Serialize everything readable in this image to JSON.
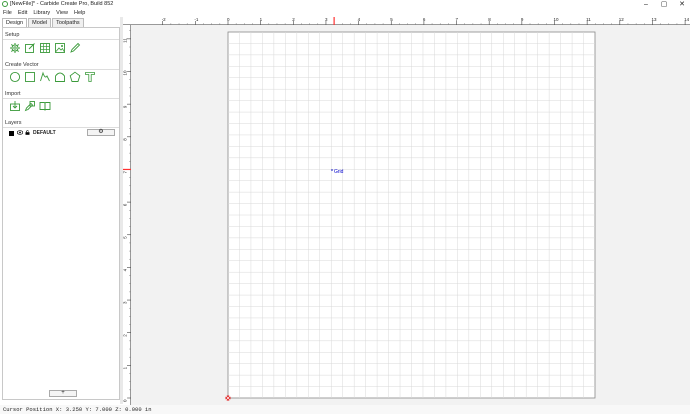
{
  "window": {
    "title": "[NewFile]* - Carbide Create Pro, Build 852",
    "minimize": "–",
    "maximize": "▢",
    "close": "✕"
  },
  "menu": [
    "File",
    "Edit",
    "Library",
    "View",
    "Help"
  ],
  "tabs": [
    "Design",
    "Model",
    "Toolpaths"
  ],
  "sections": {
    "setup": "Setup",
    "create_vector": "Create Vector",
    "import": "Import",
    "layers": "Layers"
  },
  "icons": {
    "setup": [
      "gear-icon",
      "edit-icon",
      "grid-icon",
      "image-icon",
      "pencil-icon"
    ],
    "create_vector": [
      "circle-icon",
      "rectangle-icon",
      "curve-icon",
      "polygon-icon",
      "pentagon-icon",
      "text-icon"
    ],
    "import": [
      "import-icon",
      "bitmap-trace-icon",
      "library-icon"
    ]
  },
  "layers": [
    {
      "name": "DEFAULT",
      "color": "#000000"
    }
  ],
  "layer_settings_glyph": "⚙",
  "add_layer_glyph": "+",
  "ruler": {
    "top_labels": [
      "-2",
      "-1",
      "0",
      "1",
      "2",
      "3",
      "4",
      "5",
      "6",
      "7",
      "8",
      "9",
      "10",
      "11",
      "12",
      "13",
      "14"
    ],
    "left_labels": [
      "11",
      "10",
      "9",
      "8",
      "7",
      "6",
      "5",
      "4",
      "3",
      "2",
      "1",
      "0"
    ]
  },
  "canvas": {
    "label": "Grid",
    "accent": "#2a7a2a"
  },
  "status": {
    "text": "Cursor Position X: 3.250 Y: 7.000 Z: 0.000 in"
  }
}
